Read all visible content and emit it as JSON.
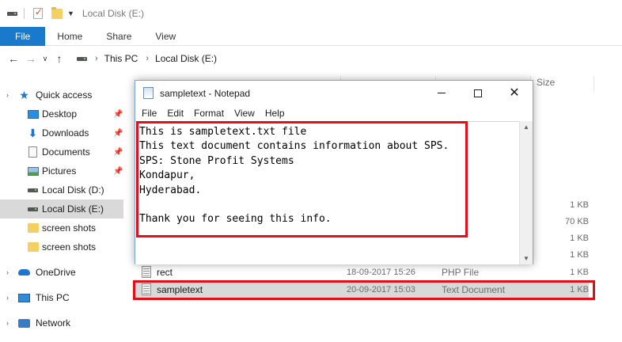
{
  "window": {
    "title": "Local Disk (E:)"
  },
  "ribbon": {
    "tabs": [
      "File",
      "Home",
      "Share",
      "View"
    ]
  },
  "address": {
    "crumbs": [
      "This PC",
      "Local Disk (E:)"
    ]
  },
  "nav": {
    "quick_access": "Quick access",
    "items": [
      {
        "label": "Desktop",
        "icon": "desktop-icon",
        "pinned": true
      },
      {
        "label": "Downloads",
        "icon": "download-icon",
        "pinned": true
      },
      {
        "label": "Documents",
        "icon": "document-icon",
        "pinned": true
      },
      {
        "label": "Pictures",
        "icon": "picture-icon",
        "pinned": true
      },
      {
        "label": "Local Disk (D:)",
        "icon": "drive-icon",
        "pinned": false
      },
      {
        "label": "Local Disk (E:)",
        "icon": "drive-icon",
        "pinned": false,
        "selected": true
      },
      {
        "label": "screen shots",
        "icon": "folder-icon",
        "pinned": false
      },
      {
        "label": "screen shots",
        "icon": "folder-icon",
        "pinned": false
      }
    ],
    "onedrive": "OneDrive",
    "this_pc": "This PC",
    "network": "Network"
  },
  "filelist": {
    "columns": {
      "size": "Size"
    },
    "partial_sizes": [
      "1 KB",
      "70 KB",
      "1 KB",
      "1 KB"
    ],
    "rows": [
      {
        "name": "rect",
        "date": "18-09-2017 15:26",
        "type": "PHP File",
        "size": "1 KB",
        "selected": false
      },
      {
        "name": "sampletext",
        "date": "20-09-2017 15:03",
        "type": "Text Document",
        "size": "1 KB",
        "selected": true
      }
    ]
  },
  "notepad": {
    "title": "sampletext - Notepad",
    "menu": [
      "File",
      "Edit",
      "Format",
      "View",
      "Help"
    ],
    "content": "This is sampletext.txt file\nThis text document contains information about SPS.\nSPS: Stone Profit Systems\nKondapur,\nHyderabad.\n\nThank you for seeing this info."
  },
  "colors": {
    "accent": "#1979ca",
    "highlight": "#e0101a",
    "selection": "#d9d9d9"
  }
}
